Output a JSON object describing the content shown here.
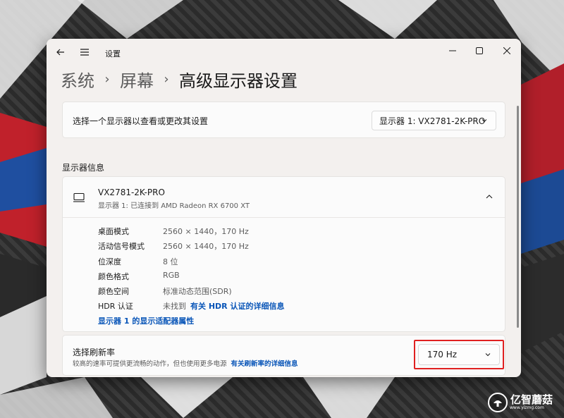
{
  "window": {
    "title": "设置"
  },
  "breadcrumb": {
    "items": [
      "系统",
      "屏幕"
    ],
    "current": "高级显示器设置",
    "separator": "›"
  },
  "display_select": {
    "label": "选择一个显示器以查看或更改其设置",
    "selected": "显示器 1: VX2781-2K-PRO"
  },
  "display_info": {
    "section_title": "显示器信息",
    "monitor_name": "VX2781-2K-PRO",
    "monitor_sub": "显示器 1: 已连接到 AMD Radeon RX 6700 XT",
    "rows": [
      {
        "label": "桌面模式",
        "value": "2560 × 1440，170 Hz"
      },
      {
        "label": "活动信号模式",
        "value": "2560 × 1440，170 Hz"
      },
      {
        "label": "位深度",
        "value": "8 位"
      },
      {
        "label": "颜色格式",
        "value": "RGB"
      },
      {
        "label": "颜色空间",
        "value": "标准动态范围(SDR)"
      },
      {
        "label": "HDR 认证",
        "value": "未找到",
        "link": "有关 HDR 认证的详细信息"
      }
    ],
    "adapter_link": "显示器 1 的显示适配器属性"
  },
  "refresh_rate": {
    "label": "选择刷新率",
    "description": "较高的速率可提供更流畅的动作，但也使用更多电源",
    "link": "有关刷新率的详细信息",
    "selected": "170 Hz"
  },
  "watermark": {
    "text": "亿智蘑菇",
    "url": "www.yizmg.com"
  },
  "colors": {
    "accent": "#0a56b8",
    "highlight": "#e02020",
    "window_bg": "#f3f0ee"
  }
}
